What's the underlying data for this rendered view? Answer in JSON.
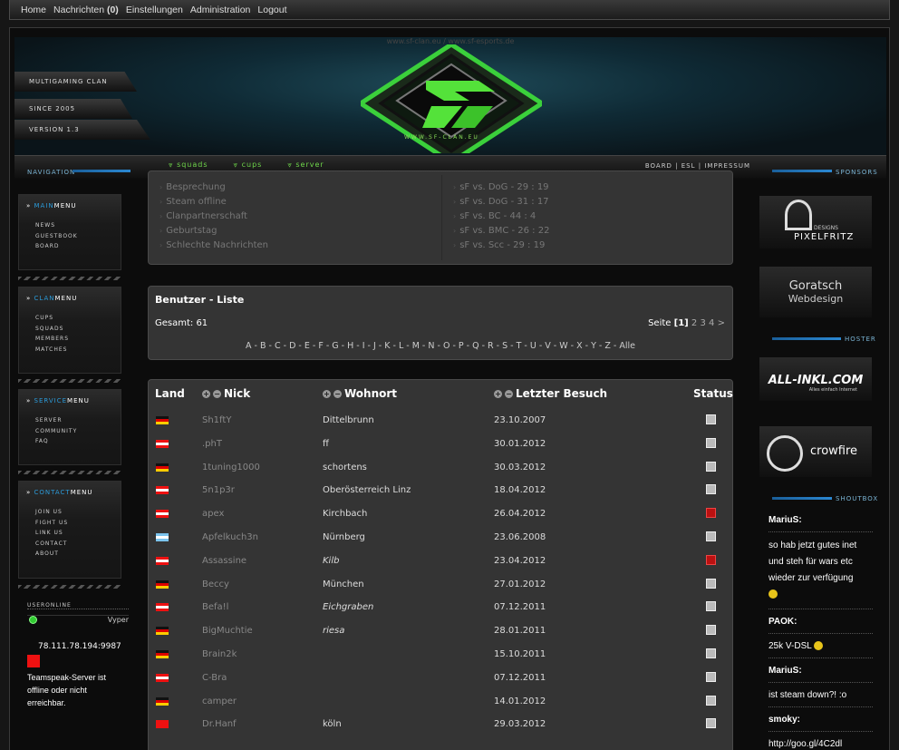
{
  "topnav": {
    "home": "Home",
    "messages": "Nachrichten",
    "messages_count": "(0)",
    "settings": "Einstellungen",
    "admin": "Administration",
    "logout": "Logout"
  },
  "header": {
    "url": "www.sf-clan.eu / www.sf-esports.de",
    "tag1": "MULTIGAMING CLAN",
    "tag2": "SINCE 2005",
    "tag3": "VERSION 1.3",
    "site": "WWW.SF-CLAN.EU"
  },
  "nav": {
    "squads": "squads",
    "cups": "cups",
    "server": "server",
    "right": "BOARD  |  ESL  |  IMPRESSUM"
  },
  "sections": {
    "navigation": "NAVIGATION",
    "sponsors": "SPONSORS",
    "hoster": "HOSTER",
    "shoutbox": "SHOUTBOX"
  },
  "menus": [
    {
      "pre": "MAIN",
      "post": "MENU",
      "items": [
        "NEWS",
        "GUESTBOOK",
        "BOARD"
      ]
    },
    {
      "pre": "CLAN",
      "post": "MENU",
      "items": [
        "CUPS",
        "SQUADS",
        "MEMBERS",
        "MATCHES"
      ]
    },
    {
      "pre": "SERVICE",
      "post": "MENU",
      "items": [
        "SERVER",
        "COMMUNITY",
        "FAQ"
      ]
    },
    {
      "pre": "CONTACT",
      "post": "MENU",
      "items": [
        "JOIN US",
        "FIGHT US",
        "LINK US",
        "CONTACT",
        "ABOUT"
      ]
    }
  ],
  "useronline": {
    "label": "USERONLINE",
    "user": "Vyper"
  },
  "teamspeak": {
    "ip": "78.111.78.194:9987",
    "status": "Teamspeak-Server ist offline oder nicht erreichbar."
  },
  "news": {
    "left": [
      "Besprechung",
      "Steam offline",
      "Clanpartnerschaft",
      "Geburtstag",
      "Schlechte Nachrichten"
    ],
    "right": [
      "sF vs. DoG - 29 : 19",
      "sF vs. DoG - 31 : 17",
      "sF vs. BC - 44 : 4",
      "sF vs. BMC - 26 : 22",
      "sF vs. Scc - 29 : 19"
    ]
  },
  "userlist": {
    "title": "Benutzer - Liste",
    "total": "Gesamt: 61",
    "page_label": "Seite",
    "current_page": "[1]",
    "pages": [
      "2",
      "3",
      "4"
    ],
    "next": ">",
    "alphabet": "A - B - C - D - E - F - G - H - I - J - K - L - M - N - O - P - Q - R - S - T - U - V - W - X - Y - Z - Alle"
  },
  "table": {
    "headers": {
      "land": "Land",
      "nick": "Nick",
      "wohnort": "Wohnort",
      "besuch": "Letzter Besuch",
      "status": "Status"
    },
    "rows": [
      {
        "flag": "de",
        "nick": "Sh1ftY",
        "ort": "Dittelbrunn",
        "date": "23.10.2007",
        "status": "offline"
      },
      {
        "flag": "at",
        "nick": ".phT",
        "ort": "ff",
        "date": "30.01.2012",
        "status": "offline"
      },
      {
        "flag": "de",
        "nick": "1tuning1000",
        "ort": "schortens",
        "date": "30.03.2012",
        "status": "offline"
      },
      {
        "flag": "at",
        "nick": "5n1p3r",
        "ort": "Oberösterreich Linz",
        "date": "18.04.2012",
        "status": "offline"
      },
      {
        "flag": "at",
        "nick": "apex",
        "ort": "Kirchbach",
        "date": "26.04.2012",
        "status": "online"
      },
      {
        "flag": "ar",
        "nick": "Apfelkuch3n",
        "ort": "Nürnberg",
        "date": "23.06.2008",
        "status": "offline"
      },
      {
        "flag": "at",
        "nick": "Assassine",
        "ort": "Kilb",
        "date": "23.04.2012",
        "status": "online"
      },
      {
        "flag": "de",
        "nick": "Beccy",
        "ort": "München",
        "date": "27.01.2012",
        "status": "offline"
      },
      {
        "flag": "at",
        "nick": "Befa!l",
        "ort": "Eichgraben",
        "date": "07.12.2011",
        "status": "offline"
      },
      {
        "flag": "de",
        "nick": "BigMuchtie",
        "ort": "riesa",
        "date": "28.01.2011",
        "status": "offline"
      },
      {
        "flag": "de",
        "nick": "Brain2k",
        "ort": "",
        "date": "15.10.2011",
        "status": "offline"
      },
      {
        "flag": "at",
        "nick": "C-Bra",
        "ort": "",
        "date": "07.12.2011",
        "status": "offline"
      },
      {
        "flag": "de",
        "nick": "camper",
        "ort": "",
        "date": "14.01.2012",
        "status": "offline"
      },
      {
        "flag": "cn",
        "nick": "Dr.Hanf",
        "ort": "köln",
        "date": "29.03.2012",
        "status": "offline"
      }
    ]
  },
  "sponsors": {
    "pixelfritz": "PIXELFRITZ",
    "designs": "DESIGNS",
    "goratsch1": "Goratsch",
    "goratsch2": "Webdesign",
    "allinkl": "ALL-INKL.COM",
    "allinkl_sub": "Alles einfach Internet",
    "crowfire": "crowfire"
  },
  "shoutbox": [
    {
      "user": "MariuS:",
      "text": "so hab jetzt gutes inet und steh für wars etc wieder zur verfügung"
    },
    {
      "user": "PAOK:",
      "text": "25k V-DSL"
    },
    {
      "user": "MariuS:",
      "text": "ist steam down?! :o"
    },
    {
      "user": "smoky:",
      "text": "http://goo.gl/4C2dl"
    }
  ],
  "colors": {
    "accent_green": "#6fd64a",
    "accent_blue": "#2b9ad8",
    "status_online": "#b11111"
  }
}
